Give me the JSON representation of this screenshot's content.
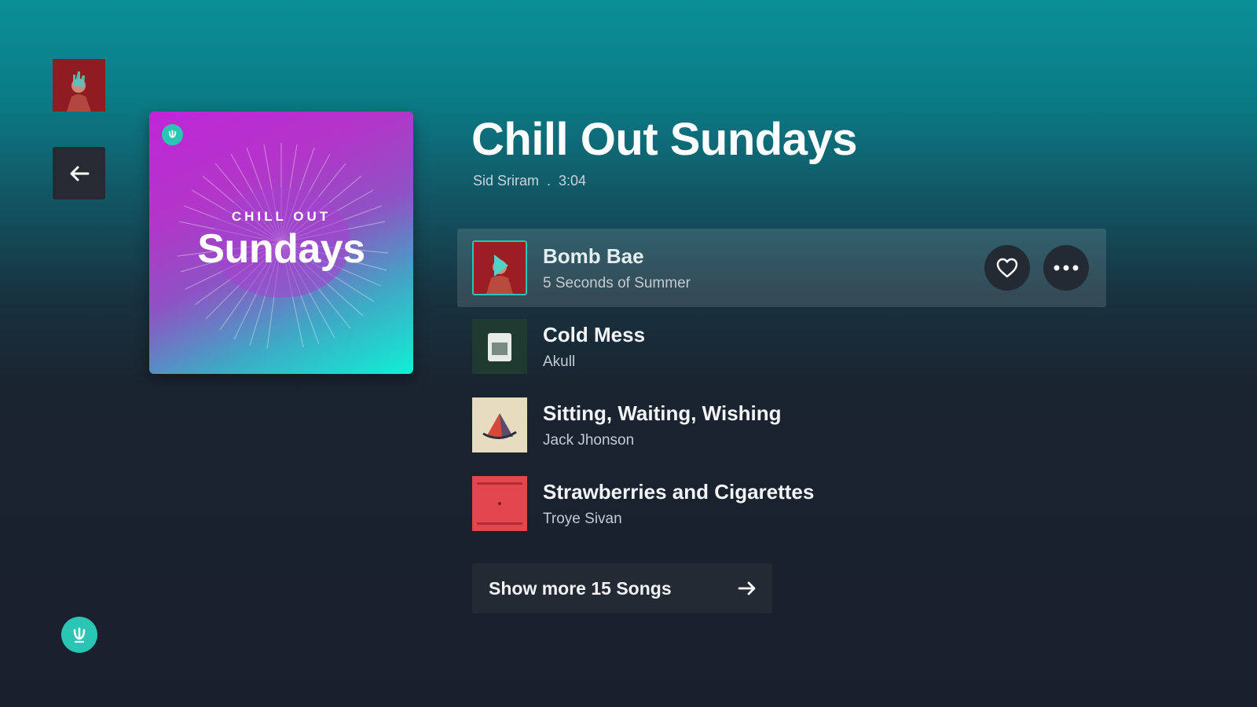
{
  "playlist": {
    "title": "Chill Out Sundays",
    "artist": "Sid Sriram",
    "separator": ".",
    "duration": "3:04",
    "cover": {
      "top_text": "CHILL OUT",
      "main_text": "Sundays"
    }
  },
  "tracks": [
    {
      "title": "Bomb Bae",
      "artist": "5 Seconds of Summer",
      "active": true
    },
    {
      "title": "Cold Mess",
      "artist": "Akull"
    },
    {
      "title": "Sitting, Waiting, Wishing",
      "artist": "Jack Jhonson"
    },
    {
      "title": "Strawberries and Cigarettes",
      "artist": "Troye Sivan"
    }
  ],
  "show_more": {
    "label": "Show more 15 Songs"
  },
  "icons": {
    "back": "arrow-left-icon",
    "favorite": "heart-icon",
    "more": "more-horizontal-icon",
    "show_more": "arrow-right-icon",
    "logo": "app-logo-icon"
  },
  "colors": {
    "accent": "#2bc5b4",
    "background_top": "#0b8f97",
    "background_bottom": "#1a1f2c"
  }
}
